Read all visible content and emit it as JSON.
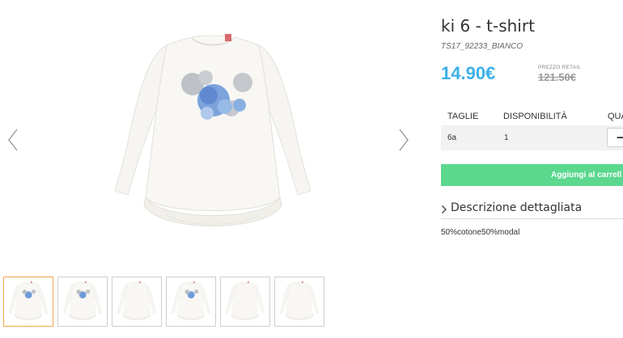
{
  "product": {
    "title": "ki 6 - t-shirt",
    "sku": "TS17_92233_BIANCO",
    "price": "14.90€",
    "retail_label": "PREZZO RETAIL",
    "retail_price": "121.50€"
  },
  "gallery": {
    "main_image_icon": "white-long-sleeve-shirt-with-blue-floral-print",
    "prev_icon": "chevron-left-icon",
    "next_icon": "chevron-right-icon",
    "thumbnails": [
      {
        "variant": "front-print",
        "active": true
      },
      {
        "variant": "front-print",
        "active": false
      },
      {
        "variant": "back-plain",
        "active": false
      },
      {
        "variant": "front-print",
        "active": false
      },
      {
        "variant": "back-plain",
        "active": false
      },
      {
        "variant": "back-plain",
        "active": false
      }
    ]
  },
  "availability_table": {
    "headers": [
      "TAGLIE",
      "DISPONIBILITÀ",
      "QUA"
    ],
    "rows": [
      {
        "size": "6a",
        "availability": "1",
        "qty_button": "−"
      }
    ]
  },
  "cart": {
    "add_label": "Aggiungi al carrell"
  },
  "description": {
    "title": "Descrizione dettagliata",
    "chevron_icon": "chevron-right-icon",
    "text": "50%cotone50%modal"
  },
  "colors": {
    "price": "#3bb0e8",
    "add_button": "#5bd88e",
    "active_thumb_border": "#f0a64a"
  }
}
